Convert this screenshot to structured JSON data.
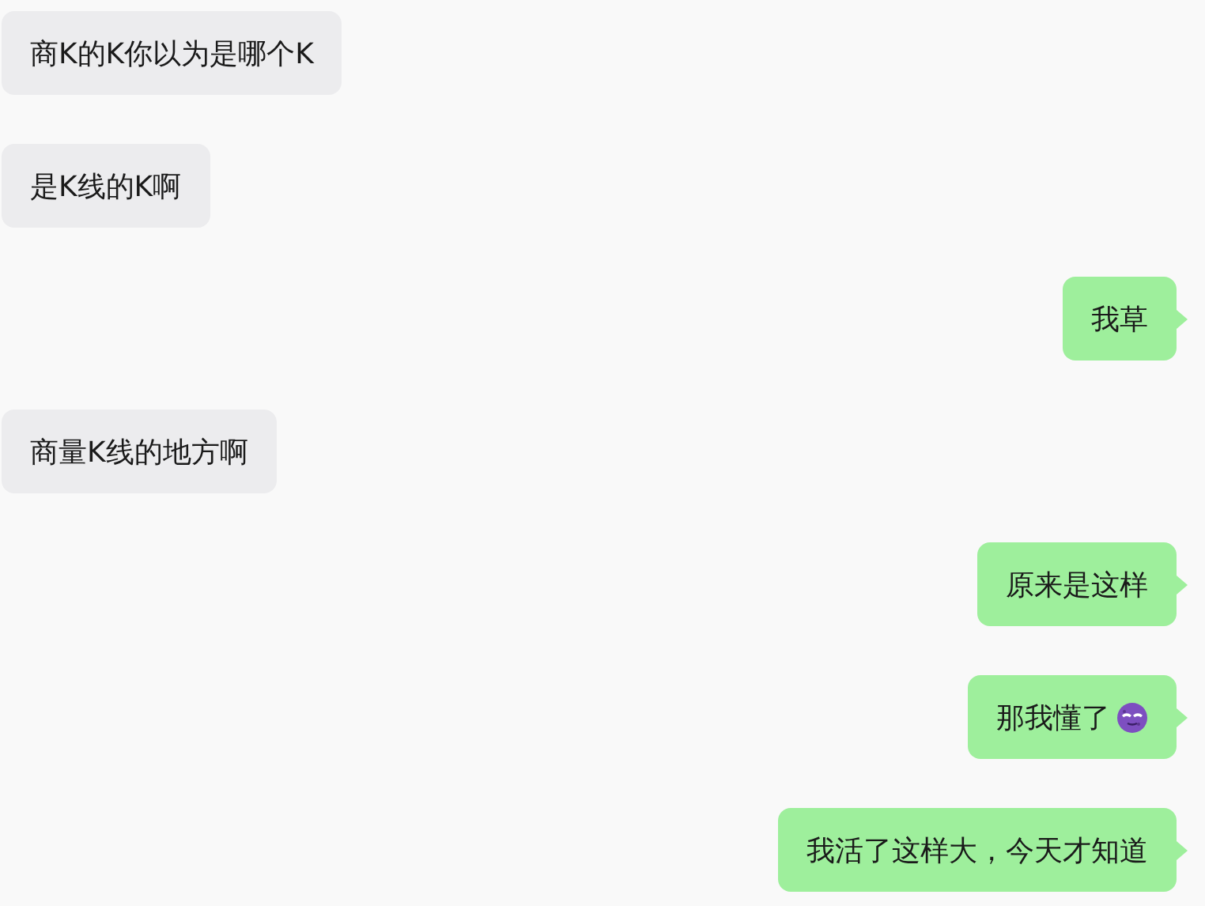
{
  "messages": [
    {
      "kind": "received",
      "text": "商K的K你以为是哪个K",
      "emoji": false
    },
    {
      "kind": "received",
      "text": "是K线的K啊",
      "emoji": false
    },
    {
      "kind": "sent",
      "text": "我草",
      "emoji": false
    },
    {
      "kind": "received",
      "text": "商量K线的地方啊",
      "emoji": false
    },
    {
      "kind": "sent",
      "text": "原来是这样",
      "emoji": false
    },
    {
      "kind": "sent",
      "text": "那我懂了",
      "emoji": true
    },
    {
      "kind": "sent",
      "text": "我活了这样大，今天才知道",
      "emoji": false
    }
  ]
}
